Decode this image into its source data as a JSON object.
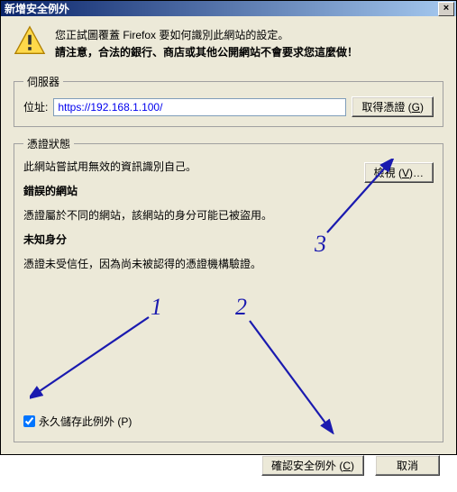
{
  "window": {
    "title": "新增安全例外",
    "close": "×"
  },
  "warning": {
    "line1": "您正試圖覆蓋 Firefox 要如何識別此網站的設定。",
    "line2": "請注意，合法的銀行、商店或其他公開網站不會要求您這麼做！"
  },
  "server": {
    "legend": "伺服器",
    "locationLabel": "位址:",
    "urlValue": "https://192.168.1.100/",
    "getCertButton": "取得憑證 (",
    "getCertMnemonic": "G",
    "getCertButtonEnd": ")"
  },
  "status": {
    "legend": "憑證狀態",
    "summary": "此網站嘗試用無效的資訊識別自己。",
    "viewButton": "檢視 (",
    "viewMnemonic": "V",
    "viewButtonEnd": ")…",
    "wrongSiteTitle": "錯誤的網站",
    "wrongSiteText": "憑證屬於不同的網站，該網站的身分可能已被盜用。",
    "unknownTitle": "未知身分",
    "unknownText": "憑證未受信任，因為尚未被認得的憑證機構驗證。",
    "permanentLabel": "永久儲存此例外 (",
    "permanentMnemonic": "P",
    "permanentLabelEnd": ")",
    "permanentChecked": true
  },
  "buttons": {
    "confirm": "確認安全例外 (",
    "confirmMnemonic": "C",
    "confirmEnd": ")",
    "cancel": "取消"
  },
  "annotations": {
    "n1": "1",
    "n2": "2",
    "n3": "3"
  }
}
